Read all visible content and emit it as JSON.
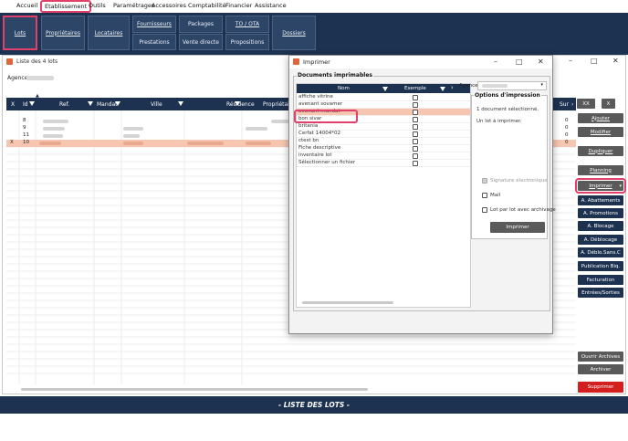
{
  "menubar": {
    "items": [
      "Accueil",
      "Etablissement",
      "Outils",
      "Paramétrages",
      "Accessoires",
      "Comptabilité",
      "Financier",
      "Assistance"
    ]
  },
  "toolbar": {
    "lots": "Lots",
    "proprietaires": "Propriétaires",
    "locataires": "Locataires",
    "fournisseurs": "Fournisseurs",
    "prestations": "Prestations",
    "packages": "Packages",
    "vente_directe": "Vente directe",
    "to_ota": "TO / OTA",
    "propositions": "Propositions",
    "dossiers": "Dossiers"
  },
  "main_window": {
    "title": "Liste des 4 lots",
    "agence_label": "Agence",
    "columns": [
      "X",
      "Id",
      "Ref.",
      "Mandat",
      "Ville",
      "Résidence",
      "Propriétaire",
      "Sur"
    ],
    "rows": [
      {
        "id": "8",
        "sur": "0"
      },
      {
        "id": "9",
        "sur": "0"
      },
      {
        "id": "11",
        "sur": "0"
      },
      {
        "x": "X",
        "id": "10",
        "sur": "0"
      }
    ],
    "footer": "- LISTE DES LOTS -"
  },
  "right_buttons": {
    "xx": "XX",
    "x": "X",
    "ajouter": "Ajouter",
    "modifier": "Modifier",
    "dupliquer": "Dupliquer",
    "planning": "Planning",
    "imprimer": "Imprimer",
    "abattements": "A. Abattements",
    "promotions": "A. Promotions",
    "blocage": "A. Blocage",
    "deblocage": "A. Déblocage",
    "deblo_sans": "A. Déblo.Sans.C",
    "publication": "Publication Biq.",
    "facturation": "Facturation",
    "entrees_sorties": "Entrées/Sorties",
    "ouvrir_archives": "Ouvrir Archives",
    "archiver": "Archiver",
    "supprimer": "Supprimer"
  },
  "dialog": {
    "title": "Imprimer",
    "group_docs": "Documents imprimables",
    "col_nom": "Nom",
    "col_exemple": "Exemple",
    "agence_label": "Agence",
    "documents": [
      "affiche vitrine",
      "avenant sovamer",
      "avenant mandat",
      "bon sivar",
      "britania",
      "Cerfat 14004*02",
      "ctest bn",
      "Fiche descriptive",
      "inventaire lot",
      "Sélectionner un fichier"
    ],
    "options_title": "Options d'impression",
    "selected_info": "1 document sélectionné.",
    "lot_info": "Un lot à imprimer.",
    "signature": "Signature électronique",
    "mail": "Mail",
    "lot_archivage": "Lot par lot avec archivage",
    "print_button": "Imprimer"
  }
}
